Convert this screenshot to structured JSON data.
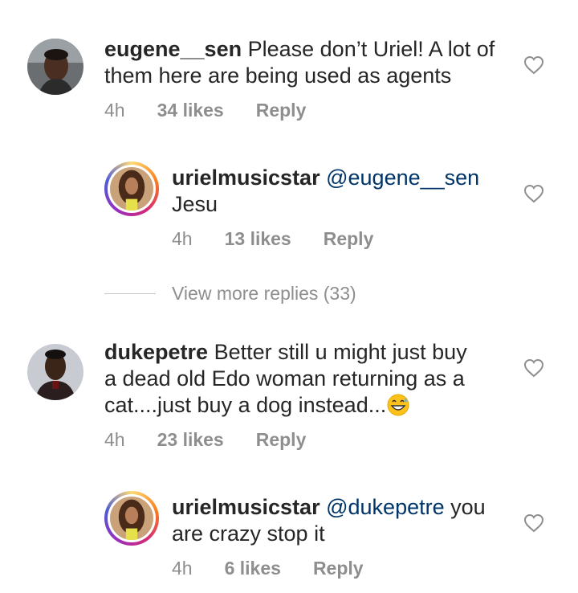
{
  "comments": [
    {
      "username": "eugene__sen",
      "text": "Please don’t Uriel! A lot of them here are being used as agents",
      "line1": "Please don’t Uriel! A lot of",
      "line2": "them here are being used as agents",
      "time": "4h",
      "likes": "34 likes",
      "reply": "Reply"
    },
    {
      "username": "urielmusicstar",
      "mention": "@eugene__sen",
      "line2": "Jesu",
      "time": "4h",
      "likes": "13 likes",
      "reply": "Reply"
    },
    {
      "username": "dukepetre",
      "line1": "Better still u might just buy",
      "line2": "a dead old Edo woman returning as a",
      "line3": "cat....just buy a dog instead...",
      "emoji": "grinning-sweat-emoji",
      "time": "4h",
      "likes": "23 likes",
      "reply": "Reply"
    },
    {
      "username": "urielmusicstar",
      "mention": "@dukepetre",
      "line1_rest": " you",
      "line2": "are crazy stop it",
      "time": "4h",
      "likes": "6 likes",
      "reply": "Reply"
    }
  ],
  "view_more_replies": "View more replies (33)",
  "colors": {
    "text": "#262626",
    "muted": "#8e8e8e",
    "mention": "#003569"
  }
}
